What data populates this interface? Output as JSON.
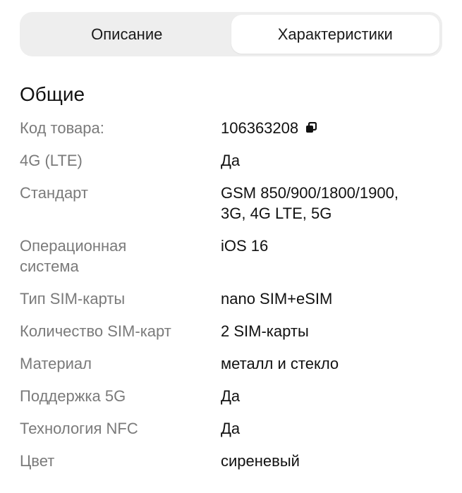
{
  "tabs": {
    "description_label": "Описание",
    "specs_label": "Характеристики",
    "active": "specs"
  },
  "section": {
    "title": "Общие"
  },
  "specs": [
    {
      "label": "Код товара:",
      "value": "106363208",
      "icon": "copy-icon"
    },
    {
      "label": "4G (LTE)",
      "value": "Да"
    },
    {
      "label": "Стандарт",
      "value": "GSM 850/900/1800/1900,\n3G, 4G LTE, 5G"
    },
    {
      "label": "Операционная\nсистема",
      "value": "iOS 16"
    },
    {
      "label": "Тип SIM-карты",
      "value": "nano SIM+eSIM"
    },
    {
      "label": "Количество SIM-карт",
      "value": "2 SIM-карты"
    },
    {
      "label": "Материал",
      "value": "металл и стекло"
    },
    {
      "label": "Поддержка 5G",
      "value": "Да"
    },
    {
      "label": "Технология NFC",
      "value": "Да"
    },
    {
      "label": "Цвет",
      "value": "сиреневый"
    }
  ],
  "colors": {
    "label_text": "#7a7a7a",
    "value_text": "#111111",
    "segment_bg": "#eeeeee",
    "segment_active_bg": "#ffffff"
  }
}
